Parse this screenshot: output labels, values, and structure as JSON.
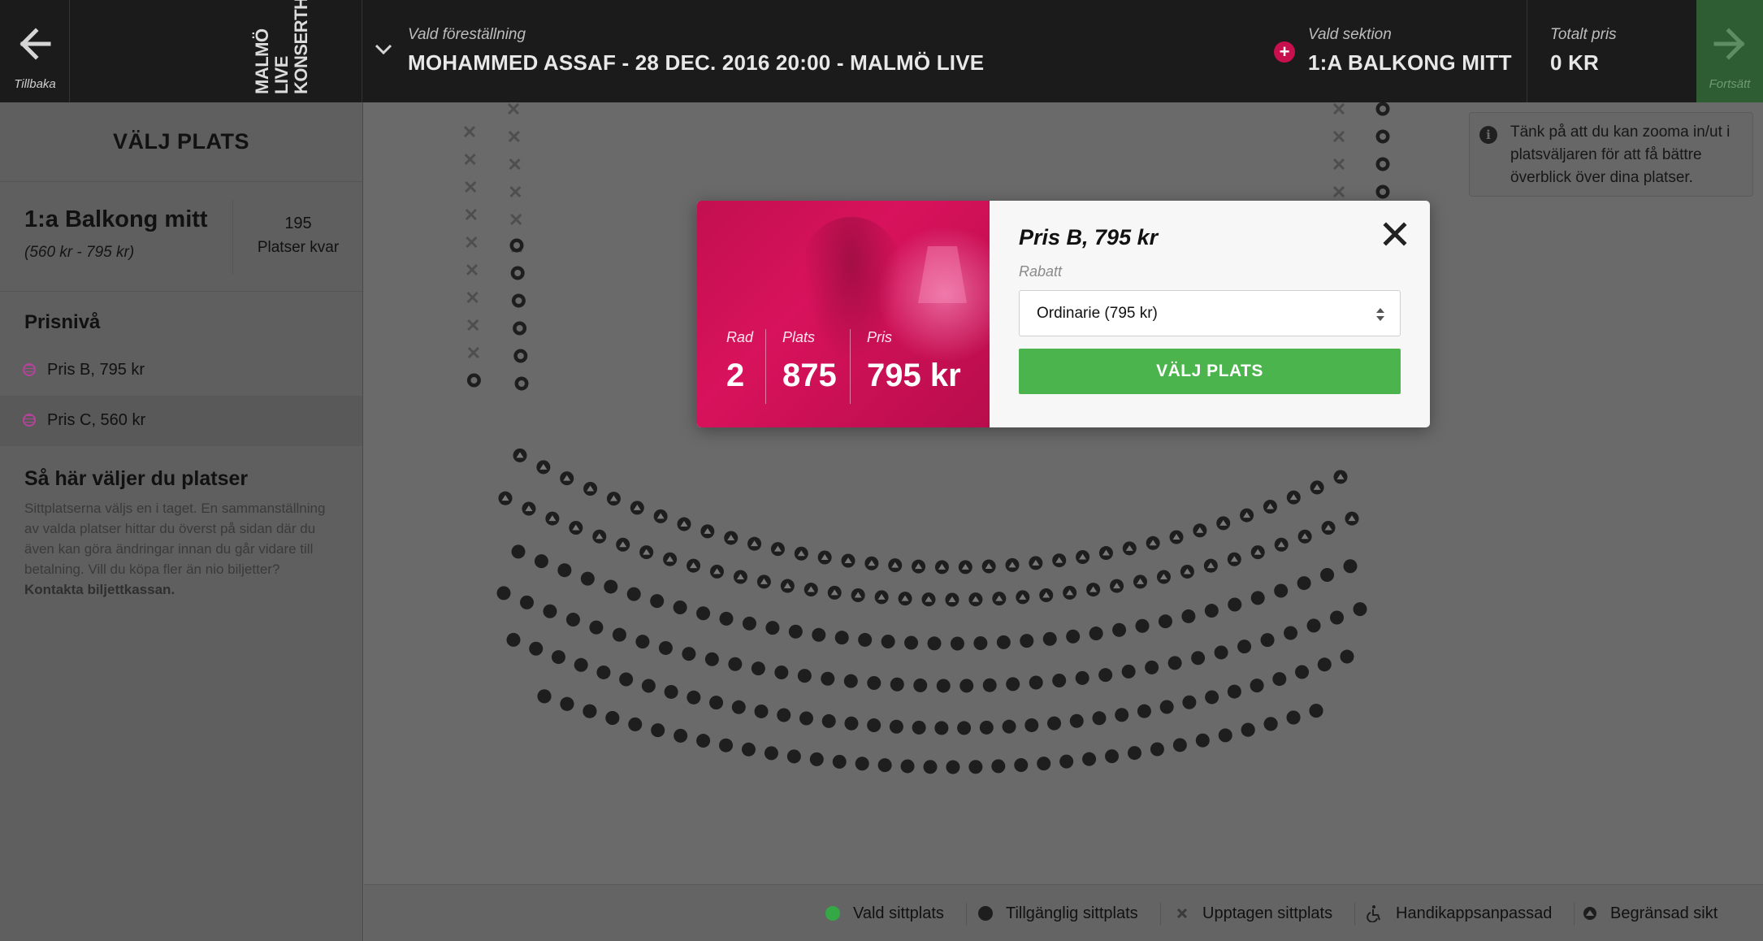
{
  "header": {
    "back_label": "Tillbaka",
    "logo_lines": [
      "MALMÖ",
      "LIVE",
      "KONSERTHUS"
    ],
    "show_label": "Vald föreställning",
    "show_value": "MOHAMMED ASSAF - 28 DEC. 2016 20:00 - MALMÖ LIVE",
    "section_label": "Vald sektion",
    "section_value": "1:A BALKONG MITT",
    "total_label": "Totalt pris",
    "total_value": "0 KR",
    "next_label": "Fortsätt"
  },
  "sidebar": {
    "title": "VÄLJ PLATS",
    "section_name": "1:a Balkong mitt",
    "section_range": "(560 kr - 795 kr)",
    "seats_left": "195",
    "seats_left_label": "Platser kvar",
    "price_heading": "Prisnivå",
    "price_levels": [
      {
        "label": "Pris B, 795 kr"
      },
      {
        "label": "Pris C, 560 kr"
      }
    ],
    "howto_heading": "Så här väljer du platser",
    "howto_text": "Sittplatserna väljs en i taget. En sammanställning av valda platser hittar du överst på sidan där du även kan göra ändringar innan du går vidare till betalning. Vill du köpa fler än nio biljetter?",
    "howto_link": "Kontakta biljettkassan."
  },
  "note": {
    "icon": "info-icon",
    "text": "Tänk på att du kan zooma in/ut i platsväljaren för att få bättre överblick över dina platser."
  },
  "modal": {
    "title": "Pris B, 795 kr",
    "row_label": "Rad",
    "row_value": "2",
    "seat_label": "Plats",
    "seat_value": "875",
    "price_label": "Pris",
    "price_value": "795 kr",
    "discount_label": "Rabatt",
    "discount_selected": "Ordinarie (795 kr)",
    "button_label": "VÄLJ PLATS"
  },
  "legend": {
    "items": [
      {
        "label": "Vald sittplats",
        "color": "#33a845"
      },
      {
        "label": "Tillgänglig sittplats",
        "color": "#1e1e1e"
      },
      {
        "label": "Upptagen sittplats",
        "icon": "cross-icon"
      },
      {
        "label": "Handikappsanpassad",
        "icon": "wheelchair-icon"
      },
      {
        "label": "Begränsad sikt",
        "icon": "limited-view-icon"
      }
    ]
  },
  "colors": {
    "header_bg": "#1b1b1b",
    "accent": "#c8104f",
    "button": "#4bb44d",
    "seat": "#1e1e1e"
  }
}
